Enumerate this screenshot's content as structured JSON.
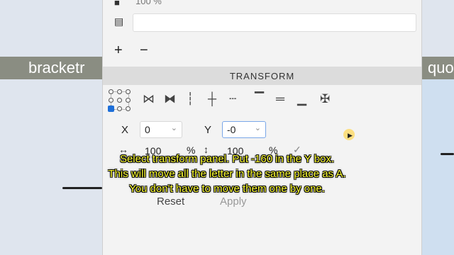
{
  "background": {
    "left_word": "bracketr",
    "right_word": "quo"
  },
  "panel": {
    "opacity_value": "100 %",
    "add_label": "+",
    "remove_label": "−",
    "section_title": "TRANSFORM",
    "position": {
      "x_label": "X",
      "x_value": "0",
      "y_label": "Y",
      "y_value": "-0"
    },
    "scale": {
      "width_value": "100",
      "width_unit": "%",
      "height_value": "100",
      "height_unit": "%"
    },
    "buttons": {
      "reset": "Reset",
      "apply": "Apply"
    }
  },
  "subtitles": [
    "Select transform panel. Put -160 in the Y box.",
    "This will move all the letter in the same place as A.",
    "You don't have to move them one by one."
  ],
  "colors": {
    "accent": "#1e6fd9",
    "subtitle": "#ffff33",
    "section_bar": "#dcdcdc"
  }
}
